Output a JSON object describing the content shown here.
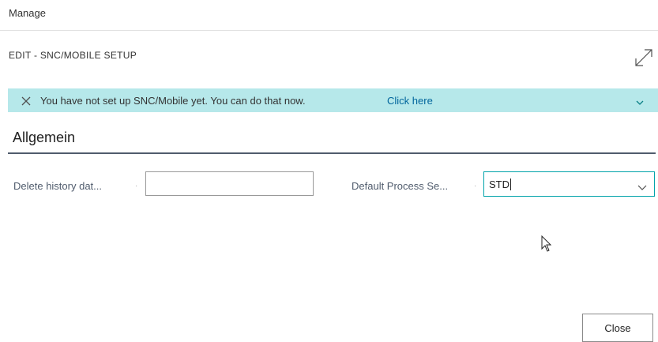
{
  "manage_bar": {
    "label": "Manage"
  },
  "page": {
    "caption": "EDIT - SNC/MOBILE SETUP",
    "expand_icon": "expand-diagonal-arrows-icon"
  },
  "notification": {
    "message": "You have not set up SNC/Mobile yet. You can do that now.",
    "link_label": "Click here",
    "background_color": "#b6e8ea",
    "link_color": "#00659c",
    "close_icon": "close-x-icon",
    "expand_icon": "chevron-down-icon"
  },
  "section": {
    "title": "Allgemein"
  },
  "fields": {
    "delete_history": {
      "label": "Delete history dat...",
      "value": ""
    },
    "default_process": {
      "label": "Default Process Se...",
      "value": "STD",
      "dropdown_icon": "chevron-down-icon"
    },
    "separator_dot": "·"
  },
  "footer": {
    "close_label": "Close"
  },
  "colors": {
    "accent": "#00a3aa",
    "section_rule": "#505c6d"
  }
}
